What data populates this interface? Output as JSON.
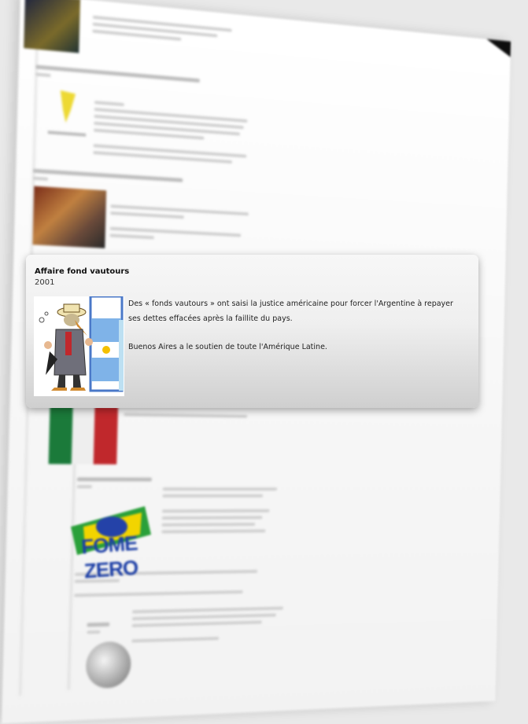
{
  "popup": {
    "title": "Affaire fond vautours",
    "year": "2001",
    "paragraphs": [
      "Des « fonds vautours » ont saisi la justice américaine pour forcer l'Argentine à repayer ses dettes effacées après la faillite du pays.",
      "Buenos Aires a le soutien de toute l'Amérique Latine."
    ],
    "image_icon": "vulture-cartoon-icon"
  },
  "background": {
    "logo_text": "FOME ZERO"
  }
}
